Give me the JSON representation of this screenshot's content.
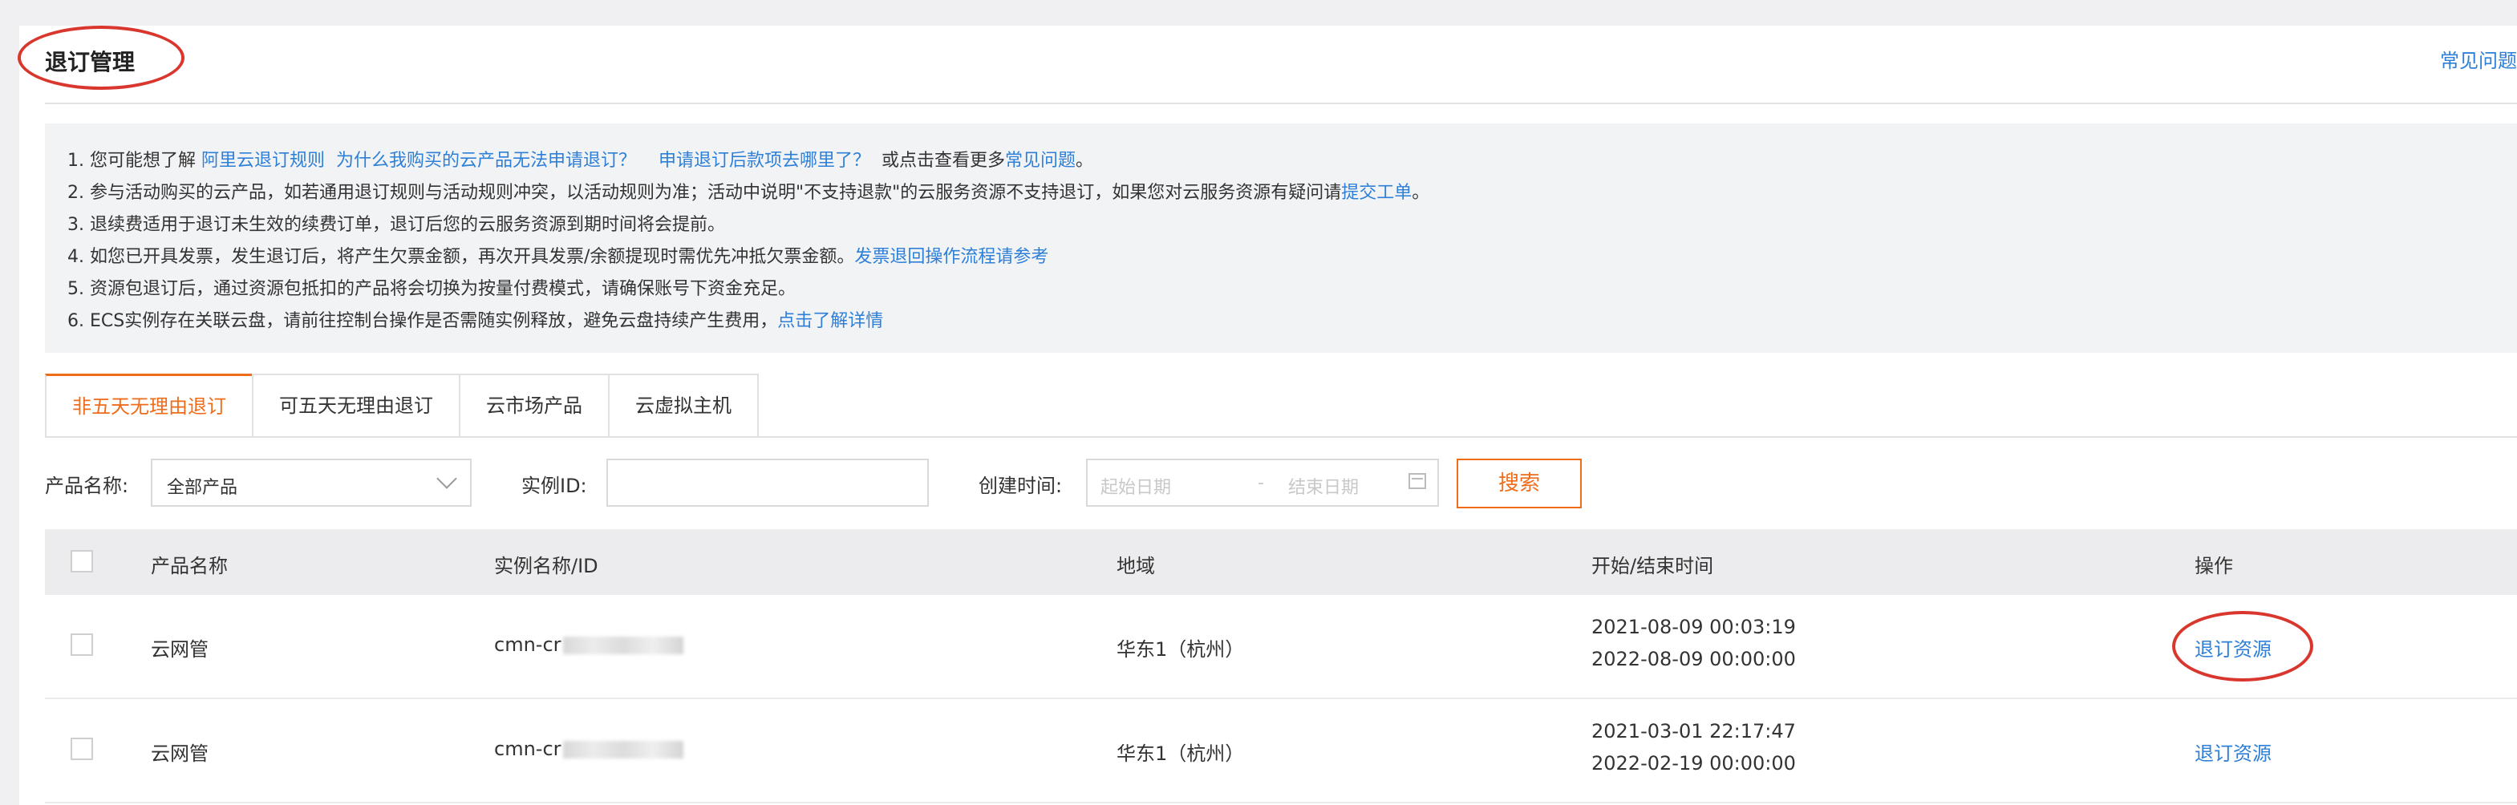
{
  "page": {
    "title": "退订管理",
    "faq_link": "常见问题"
  },
  "notice": {
    "line1": {
      "prefix": "1. 您可能想了解 ",
      "link1": "阿里云退订规则",
      "link2": "为什么我购买的云产品无法申请退订？",
      "link3": "申请退订后款项去哪里了？",
      "middle": "或点击查看更多",
      "link4": "常见问题",
      "suffix": "。"
    },
    "line2": {
      "text": "2. 参与活动购买的云产品，如若通用退订规则与活动规则冲突，以活动规则为准；活动中说明\"不支持退款\"的云服务资源不支持退订，如果您对云服务资源有疑问请",
      "link": "提交工单",
      "suffix": "。"
    },
    "line3": "3. 退续费适用于退订未生效的续费订单，退订后您的云服务资源到期时间将会提前。",
    "line4": {
      "text": "4. 如您已开具发票，发生退订后，将产生欠票金额，再次开具发票/余额提现时需优先冲抵欠票金额。",
      "link": "发票退回操作流程请参考"
    },
    "line5": "5. 资源包退订后，通过资源包抵扣的产品将会切换为按量付费模式，请确保账号下资金充足。",
    "line6": {
      "text": "6. ECS实例存在关联云盘，请前往控制台操作是否需随实例释放，避免云盘持续产生费用，",
      "link": "点击了解详情"
    }
  },
  "tabs": [
    {
      "label": "非五天无理由退订",
      "active": true
    },
    {
      "label": "可五天无理由退订",
      "active": false
    },
    {
      "label": "云市场产品",
      "active": false
    },
    {
      "label": "云虚拟主机",
      "active": false
    }
  ],
  "filters": {
    "product_label": "产品名称:",
    "product_value": "全部产品",
    "instance_label": "实例ID:",
    "instance_value": "",
    "created_label": "创建时间:",
    "start_placeholder": "起始日期",
    "range_sep": "-",
    "end_placeholder": "结束日期",
    "search_button": "搜索"
  },
  "table": {
    "columns": [
      "产品名称",
      "实例名称/ID",
      "地域",
      "开始/结束时间",
      "操作"
    ],
    "rows": [
      {
        "product": "云网管",
        "instance_prefix": "cmn-cr",
        "region": "华东1（杭州）",
        "start": "2021-08-09 00:03:19",
        "end": "2022-08-09 00:00:00",
        "action": "退订资源"
      },
      {
        "product": "云网管",
        "instance_prefix": "cmn-cr",
        "region": "华东1（杭州）",
        "start": "2021-03-01 22:17:47",
        "end": "2022-02-19 00:00:00",
        "action": "退订资源"
      }
    ]
  },
  "colors": {
    "accent_orange": "#ef6c1a",
    "link_blue": "#2d7fd8",
    "annotation_red": "#d9372e"
  }
}
